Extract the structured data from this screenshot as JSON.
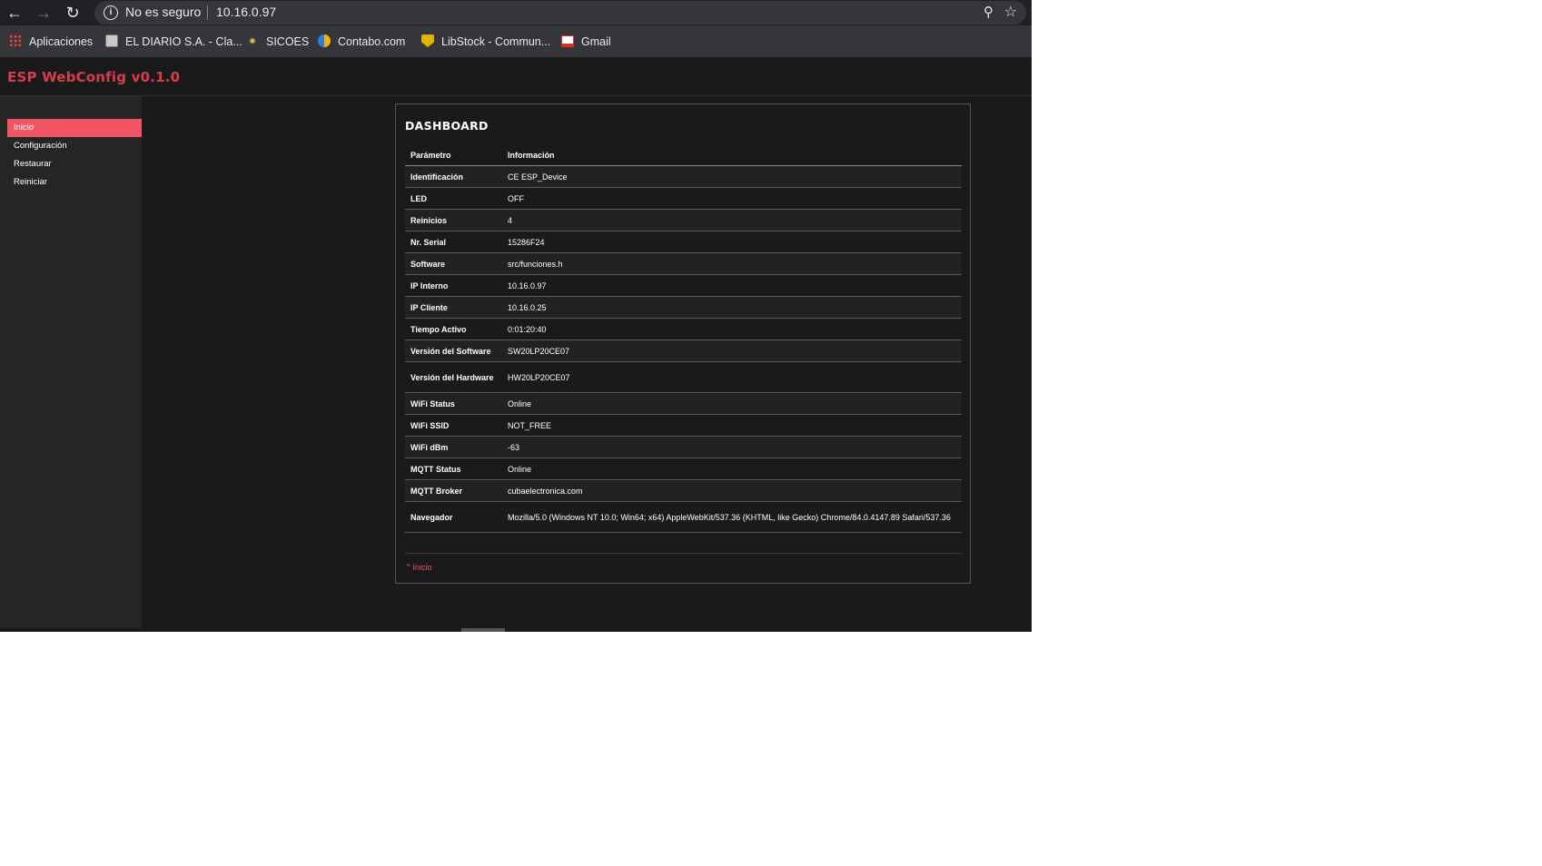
{
  "browser": {
    "address": {
      "security_label": "No es seguro",
      "url": "10.16.0.97"
    },
    "bookmarks": [
      {
        "label": "Aplicaciones",
        "icon": "apps-grid-icon"
      },
      {
        "label": "EL DIARIO S.A. - Cla...",
        "icon": "eldiario-favicon"
      },
      {
        "label": "SICOES",
        "icon": "sicoes-favicon"
      },
      {
        "label": "Contabo.com",
        "icon": "contabo-favicon"
      },
      {
        "label": "LibStock - Commun...",
        "icon": "libstock-favicon"
      },
      {
        "label": "Gmail",
        "icon": "gmail-favicon"
      }
    ]
  },
  "app": {
    "brand": "ESP WebConfig v0.1.0",
    "accent_color": "#f05563",
    "sidebar": {
      "items": [
        {
          "label": "Inicio",
          "active": true
        },
        {
          "label": "Configuración",
          "active": false
        },
        {
          "label": "Restaurar",
          "active": false
        },
        {
          "label": "Reiniciar",
          "active": false
        }
      ]
    },
    "dashboard": {
      "title": "DASHBOARD",
      "headers": [
        "Parámetro",
        "Información"
      ],
      "rows": [
        {
          "key": "Identificación",
          "value": "CE ESP_Device"
        },
        {
          "key": "LED",
          "value": "OFF"
        },
        {
          "key": "Reinicios",
          "value": "4"
        },
        {
          "key": "Nr. Serial",
          "value": "15286F24"
        },
        {
          "key": "Software",
          "value": "src/funciones.h"
        },
        {
          "key": "IP Interno",
          "value": "10.16.0.97"
        },
        {
          "key": "IP Cliente",
          "value": "10.16.0.25"
        },
        {
          "key": "Tiempo Activo",
          "value": "0:01:20:40"
        },
        {
          "key": "Versión del Software",
          "value": "SW20LP20CE07"
        },
        {
          "key": "Versión del Hardware",
          "value": "HW20LP20CE07"
        },
        {
          "key": "WiFi Status",
          "value": "Online"
        },
        {
          "key": "WiFi SSID",
          "value": "NOT_FREE"
        },
        {
          "key": "WiFi dBm",
          "value": "-63"
        },
        {
          "key": "MQTT Status",
          "value": "Online"
        },
        {
          "key": "MQTT Broker",
          "value": "cubaelectronica.com"
        },
        {
          "key": "Navegador",
          "value": "Mozilla/5.0 (Windows NT 10.0; Win64; x64) AppleWebKit/537.36 (KHTML, like Gecko) Chrome/84.0.4147.89 Safari/537.36"
        }
      ],
      "back_link": "Inicio"
    }
  }
}
